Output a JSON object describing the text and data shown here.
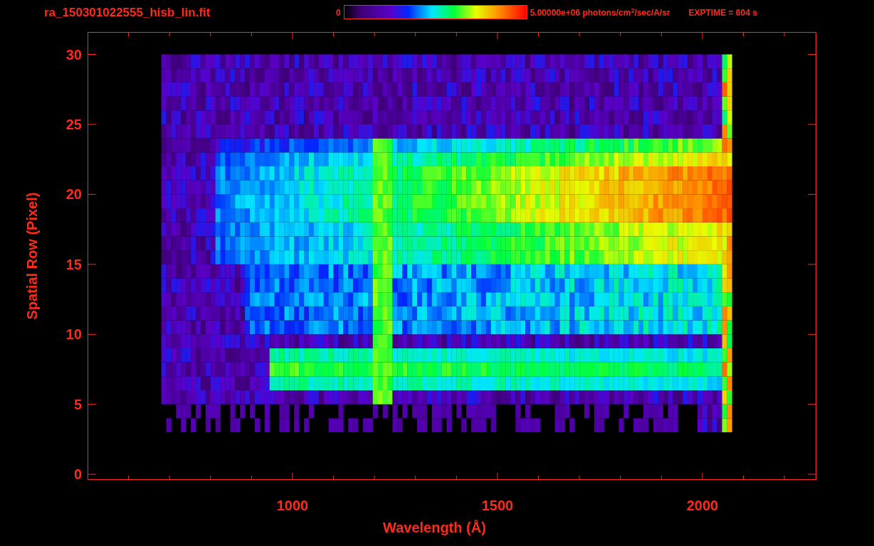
{
  "title": "ra_150301022555_hisb_lin.fit",
  "colorbar": {
    "min_label": "0",
    "max_label": "5.00000e+06 photons/cm$^{2}$/sec/A/sr"
  },
  "exposure": "EXPTIME = 604 s",
  "plot": {
    "ylabel": "Spatial Row (Pixel)",
    "xlabel": "Wavelength (Å)",
    "yticks": [
      "30",
      "25",
      "20",
      "15",
      "10",
      "5",
      "0"
    ],
    "xticks": [
      "1000",
      "1500",
      "2000"
    ]
  }
}
